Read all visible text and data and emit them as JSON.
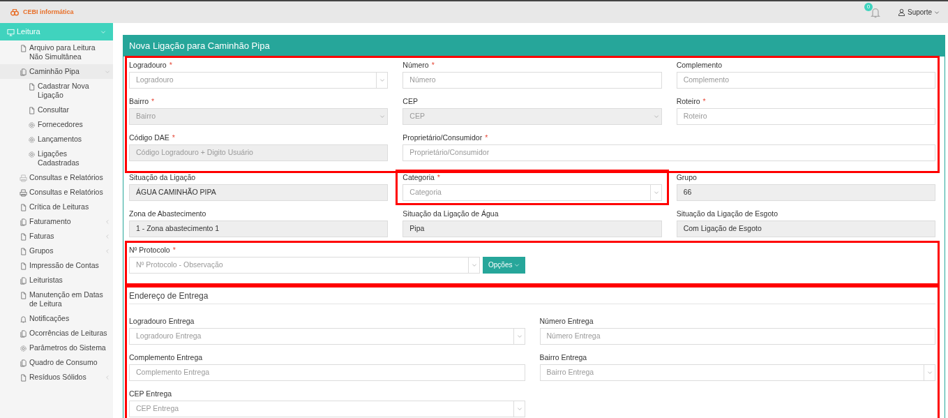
{
  "header": {
    "logo": "CEBI informática",
    "notifications": {
      "count": "0"
    },
    "user": {
      "name": "Suporte"
    }
  },
  "sidebar": {
    "items": [
      {
        "label": "Leitura",
        "kind": "monitor",
        "selected": true,
        "expanded": true,
        "children": [
          {
            "label": "Arquivo para Leitura Não Simultânea",
            "kind": "page",
            "selected": false
          },
          {
            "label": "Caminhão Pipa",
            "kind": "pages",
            "selected": false,
            "expanded": true,
            "children": [
              {
                "label": "Cadastrar Nova Ligação",
                "kind": "page",
                "selected": false
              },
              {
                "label": "Consultar",
                "kind": "page",
                "selected": false
              },
              {
                "label": "Fornecedores",
                "kind": "gear",
                "selected": false
              },
              {
                "label": "Lançamentos",
                "kind": "gear",
                "selected": false
              },
              {
                "label": "Ligações Cadastradas",
                "kind": "gear",
                "selected": false
              }
            ]
          },
          {
            "label": "Consultas e Relatórios",
            "kind": "printer-faint",
            "selected": false
          },
          {
            "label": "Consultas e Relatórios",
            "kind": "printer",
            "selected": false
          },
          {
            "label": "Crítica de Leituras",
            "kind": "page",
            "selected": false
          },
          {
            "label": "Faturamento",
            "kind": "pages",
            "selected": false,
            "expanded": false
          },
          {
            "label": "Faturas",
            "kind": "page",
            "selected": false,
            "expanded": false
          },
          {
            "label": "Grupos",
            "kind": "page",
            "selected": false,
            "expanded": false
          },
          {
            "label": "Impressão de Contas",
            "kind": "page",
            "selected": false
          },
          {
            "label": "Leituristas",
            "kind": "pages",
            "selected": false
          },
          {
            "label": "Manutenção em Datas de Leitura",
            "kind": "page",
            "selected": false
          },
          {
            "label": "Notificações",
            "kind": "bell",
            "selected": false
          },
          {
            "label": "Ocorrências de Leituras",
            "kind": "pages",
            "selected": false
          },
          {
            "label": "Parâmetros do Sistema",
            "kind": "gear",
            "selected": false
          },
          {
            "label": "Quadro de Consumo",
            "kind": "pages",
            "selected": false
          },
          {
            "label": "Resíduos Sólidos",
            "kind": "page",
            "selected": false,
            "expanded": false
          }
        ]
      }
    ]
  },
  "form": {
    "title": "Nova Ligação para Caminhão Pipa",
    "blocks": [
      {
        "kind": "grid3",
        "highlighted": true,
        "fields": [
          {
            "label": "Logradouro",
            "marker": "*",
            "kind": "select",
            "placeholder": "Logradouro",
            "disabled": false,
            "highlighted": false
          },
          {
            "label": "Número",
            "marker": "*",
            "kind": "input",
            "placeholder": "Número",
            "disabled": false,
            "highlighted": false
          },
          {
            "label": "Complemento",
            "kind": "input",
            "placeholder": "Complemento",
            "disabled": false,
            "highlighted": false
          },
          {
            "label": "Bairro",
            "marker": "*",
            "kind": "select",
            "placeholder": "Bairro",
            "disabled": true,
            "highlighted": false
          },
          {
            "label": "CEP",
            "kind": "select",
            "placeholder": "CEP",
            "disabled": true,
            "highlighted": false
          },
          {
            "label": "Roteiro",
            "marker": "*",
            "kind": "input",
            "placeholder": "Roteiro",
            "disabled": false,
            "highlighted": false
          },
          {
            "label": "Código DAE",
            "marker": "*",
            "kind": "input",
            "placeholder": "Código Logradouro + Digito Usuário",
            "disabled": true,
            "highlighted": false
          },
          {
            "label": "Proprietário/Consumidor",
            "marker": "*",
            "kind": "input",
            "placeholder": "Proprietário/Consumidor",
            "disabled": false,
            "highlighted": false,
            "wide": true
          }
        ]
      },
      {
        "kind": "grid3",
        "highlighted": false,
        "fields": [
          {
            "label": "Situação da Ligação",
            "kind": "input",
            "value": "ÁGUA CAMINHÃO PIPA",
            "disabled": true,
            "highlighted": false
          },
          {
            "label": "Categoria",
            "marker": "*",
            "kind": "select",
            "placeholder": "Categoria",
            "disabled": false,
            "highlighted": true
          },
          {
            "label": "Grupo",
            "kind": "input",
            "value": "66",
            "disabled": true,
            "highlighted": false
          },
          {
            "label": "Zona de Abastecimento",
            "kind": "input",
            "value": "1 - Zona abastecimento 1",
            "disabled": true,
            "highlighted": false
          },
          {
            "label": "Situação da Ligação de Água",
            "kind": "input",
            "value": "Pipa",
            "disabled": true,
            "highlighted": false
          },
          {
            "label": "Situação da Ligação de Esgoto",
            "kind": "input",
            "value": "Com Ligação de Esgoto",
            "disabled": true,
            "highlighted": false
          }
        ]
      },
      {
        "kind": "grid2",
        "highlighted": true,
        "fields": [
          {
            "label": "Nº Protocolo",
            "marker": "*",
            "kind": "select-button",
            "placeholder": "Nº Protocolo - Observação",
            "button": "Opções",
            "disabled": false,
            "highlighted": false
          }
        ]
      },
      {
        "kind": "grid2",
        "title": "Endereço de Entrega",
        "highlighted": true,
        "fields": [
          {
            "label": "Logradouro Entrega",
            "kind": "select",
            "placeholder": "Logradouro Entrega",
            "disabled": false,
            "highlighted": false
          },
          {
            "label": "Número Entrega",
            "kind": "input",
            "placeholder": "Número Entrega",
            "disabled": false,
            "highlighted": false
          },
          {
            "label": "Complemento Entrega",
            "kind": "input",
            "placeholder": "Complemento Entrega",
            "disabled": false,
            "highlighted": false
          },
          {
            "label": "Bairro Entrega",
            "kind": "select",
            "placeholder": "Bairro Entrega",
            "disabled": false,
            "highlighted": false
          },
          {
            "label": "CEP Entrega",
            "kind": "select",
            "placeholder": "CEP Entrega",
            "disabled": false,
            "highlighted": false
          }
        ]
      }
    ]
  }
}
